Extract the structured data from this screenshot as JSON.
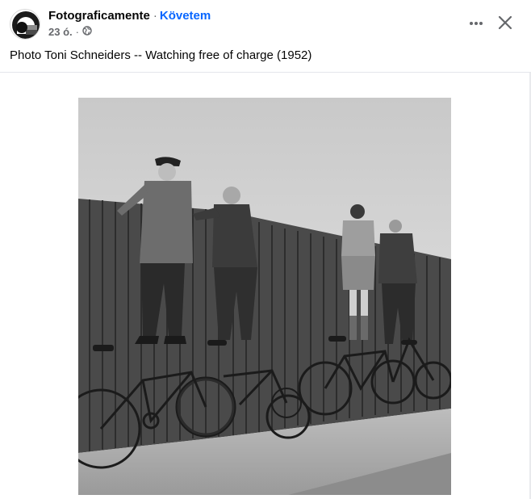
{
  "post": {
    "page_name": "Fotograficamente",
    "separator": "·",
    "follow_label": "Követem",
    "timestamp": "23 ó.",
    "meta_separator": "·",
    "audience_icon": "globe-icon",
    "caption": "Photo Toni Schneiders -- Watching free of charge (1952)"
  },
  "icons": {
    "more": "more-horizontal-icon",
    "close": "close-icon"
  },
  "colors": {
    "link_blue": "#0866ff",
    "secondary_text": "#65676b",
    "divider": "#e4e6eb"
  }
}
